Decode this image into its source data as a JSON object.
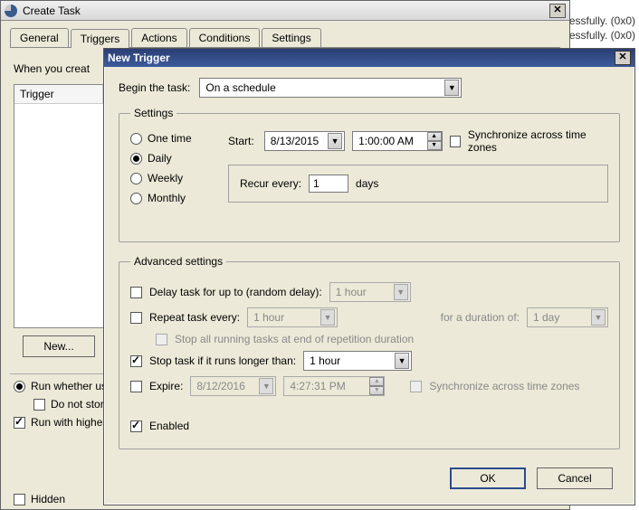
{
  "bg": {
    "line1": "essfully. (0x0)",
    "line2": "essfully. (0x0)"
  },
  "create_task": {
    "title": "Create Task",
    "tabs": [
      "General",
      "Triggers",
      "Actions",
      "Conditions",
      "Settings"
    ],
    "active_tab_index": 1,
    "intro": "When you creat",
    "grid_header": "Trigger",
    "new_button": "New...",
    "run_whether_label": "Run whether use",
    "do_not_store_label": "Do not store",
    "run_highest_label": "Run with highes",
    "hidden_label": "Hidden",
    "run_whether_checked": true,
    "do_not_store_checked": false,
    "run_highest_checked": true,
    "hidden_checked": false
  },
  "new_trigger": {
    "title": "New Trigger",
    "begin_label": "Begin the task:",
    "begin_value": "On a schedule",
    "settings": {
      "legend": "Settings",
      "options": {
        "one_time": "One time",
        "daily": "Daily",
        "weekly": "Weekly",
        "monthly": "Monthly"
      },
      "selected": "daily",
      "start_label": "Start:",
      "start_date": "8/13/2015",
      "start_time": "1:00:00 AM",
      "sync_tz_label": "Synchronize across time zones",
      "sync_tz_checked": false,
      "recur_label": "Recur every:",
      "recur_value": "1",
      "recur_unit": "days"
    },
    "advanced": {
      "legend": "Advanced settings",
      "delay_label": "Delay task for up to (random delay):",
      "delay_checked": false,
      "delay_value": "1 hour",
      "repeat_label": "Repeat task every:",
      "repeat_checked": false,
      "repeat_value": "1 hour",
      "duration_label": "for a duration of:",
      "duration_value": "1 day",
      "stop_all_label": "Stop all running tasks at end of repetition duration",
      "stop_all_checked": false,
      "stop_if_longer_label": "Stop task if it runs longer than:",
      "stop_if_longer_checked": true,
      "stop_if_longer_value": "1 hour",
      "expire_label": "Expire:",
      "expire_checked": false,
      "expire_date": "8/12/2016",
      "expire_time": "4:27:31 PM",
      "expire_sync_label": "Synchronize across time zones",
      "enabled_label": "Enabled",
      "enabled_checked": true
    },
    "buttons": {
      "ok": "OK",
      "cancel": "Cancel"
    }
  }
}
